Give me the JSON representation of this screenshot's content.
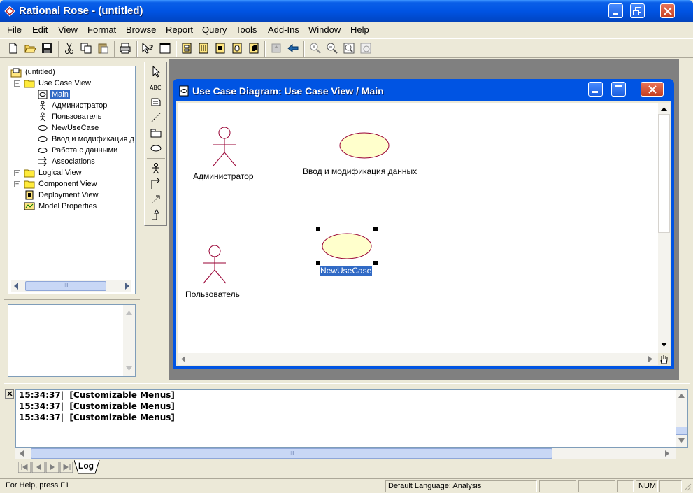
{
  "window": {
    "title": "Rational Rose - (untitled)"
  },
  "menu": [
    "File",
    "Edit",
    "View",
    "Format",
    "Browse",
    "Report",
    "Query",
    "Tools",
    "Add-Ins",
    "Window",
    "Help"
  ],
  "toolbar_icons": [
    "new-icon",
    "open-icon",
    "save-icon",
    "cut-icon",
    "copy-icon",
    "paste-icon",
    "print-icon",
    "context-help-icon",
    "view-doc-icon",
    "browse-class-diagram-icon",
    "browse-interaction-diagram-icon",
    "browse-component-diagram-icon",
    "browse-deployment-diagram-icon",
    "browse-state-diagram-icon",
    "browse-parent-icon",
    "browse-previous-icon",
    "zoom-in-icon",
    "zoom-out-icon",
    "fit-in-window-icon",
    "undo-fit-icon"
  ],
  "tree": {
    "root": "(untitled)",
    "use_case_view": "Use Case View",
    "main": "Main",
    "administrator": "Администратор",
    "user": "Пользователь",
    "new_use_case": "NewUseCase",
    "input_modify": "Ввод и модификация д",
    "work_data": "Работа с данными",
    "associations": "Associations",
    "logical_view": "Logical View",
    "component_view": "Component View",
    "deployment_view": "Deployment View",
    "model_properties": "Model Properties"
  },
  "toolbox_icons": [
    "selection-tool-icon",
    "text-box-icon",
    "note-icon",
    "anchor-note-icon",
    "package-icon",
    "use-case-icon",
    "actor-icon",
    "unidirectional-association-icon",
    "dependency-icon",
    "generalization-icon"
  ],
  "diagram_window": {
    "title": "Use Case Diagram: Use Case View / Main",
    "actor_admin_label": "Администратор",
    "actor_user_label": "Пользователь",
    "use_case_input_label": "Ввод и модификация данных",
    "use_case_new_label": "NewUseCase"
  },
  "log": {
    "lines": [
      "15:34:37|  [Customizable Menus]",
      "15:34:37|  [Customizable Menus]",
      "15:34:37|  [Customizable Menus]"
    ],
    "tab_label": "Log"
  },
  "statusbar": {
    "help": "For Help, press F1",
    "language": "Default Language: Analysis",
    "num": "NUM"
  },
  "colors": {
    "titlebar": "#0054e3",
    "selection": "#316ac5",
    "use_case_fill": "#ffffcc",
    "use_case_stroke": "#990033",
    "actor_stroke": "#990033"
  }
}
